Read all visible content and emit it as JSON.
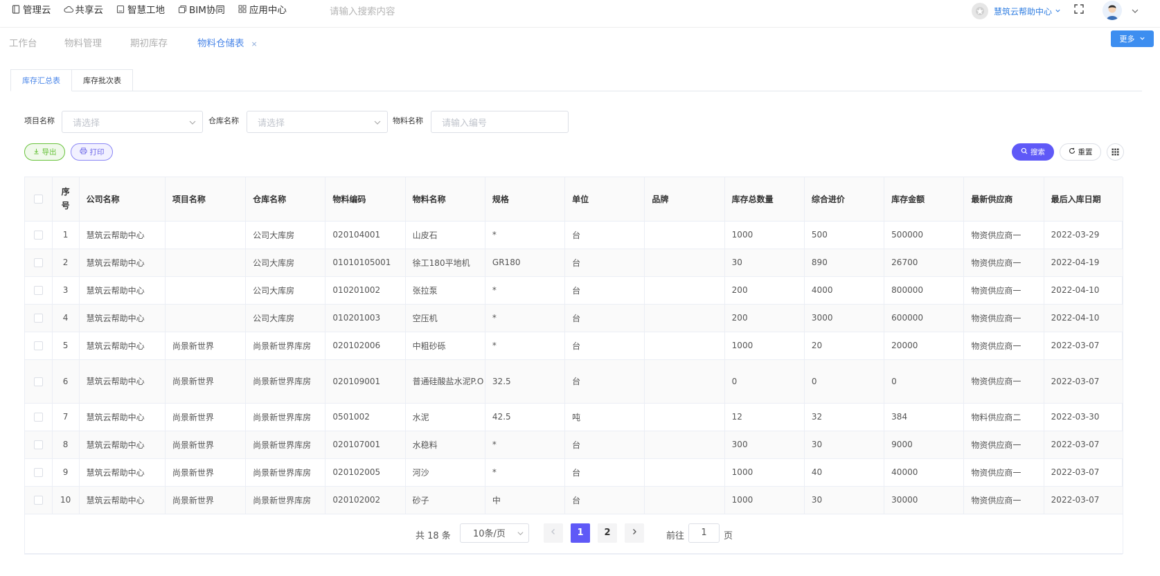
{
  "topnav": [
    {
      "label": "管理云",
      "icon": "document-icon"
    },
    {
      "label": "共享云",
      "icon": "cloud-icon"
    },
    {
      "label": "智慧工地",
      "icon": "notebook-icon"
    },
    {
      "label": "BIM协同",
      "icon": "copy-icon"
    },
    {
      "label": "应用中心",
      "icon": "grid-icon"
    }
  ],
  "header": {
    "search_placeholder": "请输入搜索内容",
    "help_center": "慧筑云帮助中心"
  },
  "page_tabs": [
    {
      "label": "工作台",
      "active": false
    },
    {
      "label": "物料管理",
      "active": false
    },
    {
      "label": "期初库存",
      "active": false
    },
    {
      "label": "物料仓储表",
      "active": true,
      "close": "×"
    }
  ],
  "more_label": "更多",
  "subtabs": [
    {
      "label": "库存汇总表",
      "active": true
    },
    {
      "label": "库存批次表",
      "active": false
    }
  ],
  "filters": {
    "project_label": "项目名称",
    "project_placeholder": "请选择",
    "warehouse_label": "仓库名称",
    "warehouse_placeholder": "请选择",
    "material_label": "物料名称",
    "material_placeholder": "请输入编号"
  },
  "actions": {
    "export": "导出",
    "print": "打印",
    "search": "搜索",
    "reset": "重置"
  },
  "table": {
    "columns": [
      "序号",
      "公司名称",
      "项目名称",
      "仓库名称",
      "物料编码",
      "物料名称",
      "规格",
      "单位",
      "品牌",
      "库存总数量",
      "综合进价",
      "库存金额",
      "最新供应商",
      "最后入库日期"
    ],
    "rows": [
      [
        "1",
        "慧筑云帮助中心",
        "",
        "公司大库房",
        "020104001",
        "山皮石",
        "*",
        "台",
        "",
        "1000",
        "500",
        "500000",
        "物资供应商一",
        "2022-03-29"
      ],
      [
        "2",
        "慧筑云帮助中心",
        "",
        "公司大库房",
        "01010105001",
        "徐工180平地机",
        "GR180",
        "台",
        "",
        "30",
        "890",
        "26700",
        "物资供应商一",
        "2022-04-19"
      ],
      [
        "3",
        "慧筑云帮助中心",
        "",
        "公司大库房",
        "010201002",
        "张拉泵",
        "*",
        "台",
        "",
        "200",
        "4000",
        "800000",
        "物资供应商一",
        "2022-04-10"
      ],
      [
        "4",
        "慧筑云帮助中心",
        "",
        "公司大库房",
        "010201003",
        "空压机",
        "*",
        "台",
        "",
        "200",
        "3000",
        "600000",
        "物资供应商一",
        "2022-04-10"
      ],
      [
        "5",
        "慧筑云帮助中心",
        "尚景新世界",
        "尚景新世界库房",
        "020102006",
        "中粗砂砾",
        "*",
        "台",
        "",
        "1000",
        "20",
        "20000",
        "物资供应商一",
        "2022-03-07"
      ],
      [
        "6",
        "慧筑云帮助中心",
        "尚景新世界",
        "尚景新世界库房",
        "020109001",
        "普通硅酸盐水泥P.O",
        "32.5",
        "台",
        "",
        "0",
        "0",
        "0",
        "物资供应商一",
        "2022-03-07"
      ],
      [
        "7",
        "慧筑云帮助中心",
        "尚景新世界",
        "尚景新世界库房",
        "0501002",
        "水泥",
        "42.5",
        "吨",
        "",
        "12",
        "32",
        "384",
        "物料供应商二",
        "2022-03-30"
      ],
      [
        "8",
        "慧筑云帮助中心",
        "尚景新世界",
        "尚景新世界库房",
        "020107001",
        "水稳料",
        "*",
        "台",
        "",
        "300",
        "30",
        "9000",
        "物资供应商一",
        "2022-03-07"
      ],
      [
        "9",
        "慧筑云帮助中心",
        "尚景新世界",
        "尚景新世界库房",
        "020102005",
        "河沙",
        "*",
        "台",
        "",
        "1000",
        "40",
        "40000",
        "物资供应商一",
        "2022-03-07"
      ],
      [
        "10",
        "慧筑云帮助中心",
        "尚景新世界",
        "尚景新世界库房",
        "020102002",
        "砂子",
        "中",
        "台",
        "",
        "1000",
        "30",
        "30000",
        "物资供应商一",
        "2022-03-07"
      ]
    ]
  },
  "pagination": {
    "total": "共 18 条",
    "page_size": "10条/页",
    "pages": [
      "1",
      "2"
    ],
    "goto_label": "前往",
    "goto_value": "1",
    "goto_suffix": "页"
  },
  "colors": {
    "primary": "#5f59f7",
    "link": "#4a86e8",
    "more_button": "#3d8ef0",
    "export": "#67c23a"
  }
}
